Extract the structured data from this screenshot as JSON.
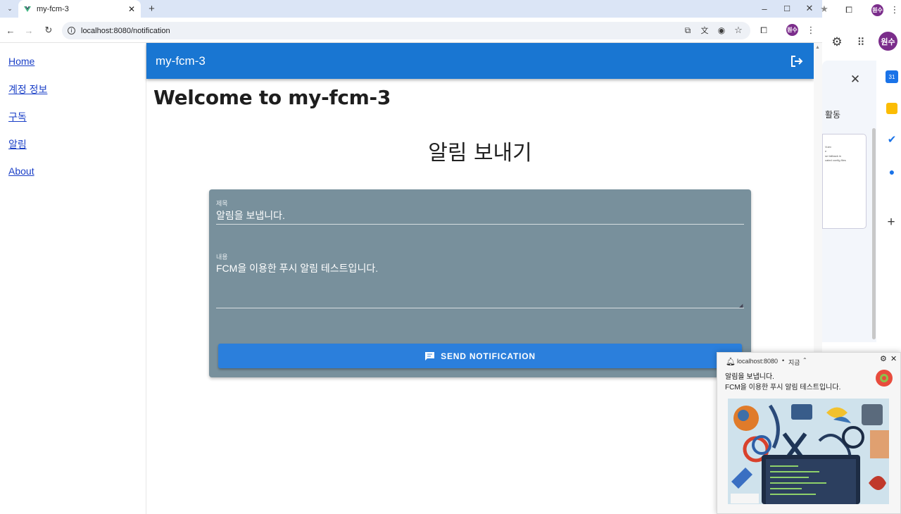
{
  "browser": {
    "tab_title": "my-fcm-3",
    "tab_close": "✕",
    "new_tab": "+",
    "url": "localhost:8080/notification",
    "profile": "원수"
  },
  "side_panel": {
    "activity_label": "활동",
    "preview_lines": [
      "Vuex",
      "e",
      "se fallback in",
      "",
      "",
      "cated config files"
    ]
  },
  "nav": {
    "items": [
      "Home",
      "계정 정보",
      "구독",
      "알림",
      "About"
    ]
  },
  "appbar": {
    "title": "my-fcm-3"
  },
  "page": {
    "welcome": "Welcome to my-fcm-3",
    "form_title": "알림 보내기"
  },
  "form": {
    "title_label": "제목",
    "title_value": "알림을 보냅니다.",
    "body_label": "내용",
    "body_value": "FCM을 이용한 푸시 알림 테스트입니다.",
    "send_label": "SEND NOTIFICATION"
  },
  "toast": {
    "source": "localhost:8080",
    "time": "지금",
    "title": "알림을 보냅니다.",
    "body": "FCM을 이용한 푸시 알림 테스트입니다."
  },
  "colors": {
    "appbar": "#1976d2",
    "card": "#78909c",
    "button": "#2b7fdc",
    "link": "#1a3fc7"
  }
}
